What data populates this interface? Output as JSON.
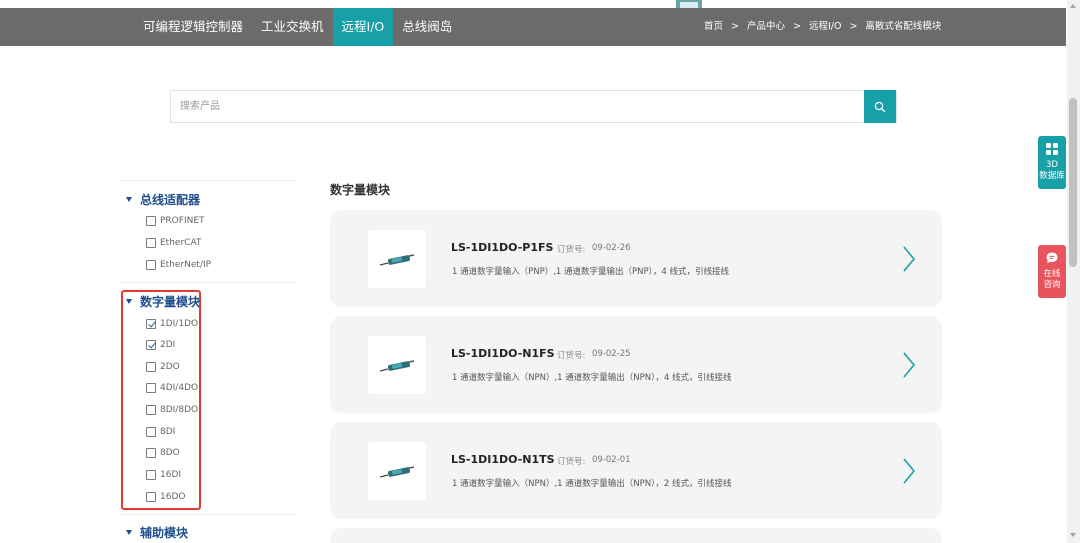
{
  "nav": {
    "items": [
      {
        "label": "可编程逻辑控制器",
        "active": false
      },
      {
        "label": "工业交换机",
        "active": false
      },
      {
        "label": "远程I/O",
        "active": true
      },
      {
        "label": "总线阀岛",
        "active": false
      }
    ],
    "breadcrumb": [
      "首页",
      "产品中心",
      "远程I/O",
      "离散式省配线模块"
    ],
    "breadcrumb_sep": ">",
    "active_color": "#17a0a8",
    "bar_color": "#6b6b6b"
  },
  "search": {
    "placeholder": "搜索产品",
    "value": "",
    "button_icon": "search-icon"
  },
  "sidebar": {
    "groups": [
      {
        "title": "总线适配器",
        "options": [
          {
            "label": "PROFINET",
            "checked": false
          },
          {
            "label": "EtherCAT",
            "checked": false
          },
          {
            "label": "EtherNet/IP",
            "checked": false
          }
        ]
      },
      {
        "title": "数字量模块",
        "options": [
          {
            "label": "1DI/1DO",
            "checked": true
          },
          {
            "label": "2DI",
            "checked": true
          },
          {
            "label": "2DO",
            "checked": false
          },
          {
            "label": "4DI/4DO",
            "checked": false
          },
          {
            "label": "8DI/8DO",
            "checked": false
          },
          {
            "label": "8DI",
            "checked": false
          },
          {
            "label": "8DO",
            "checked": false
          },
          {
            "label": "16DI",
            "checked": false
          },
          {
            "label": "16DO",
            "checked": false
          }
        ]
      },
      {
        "title": "辅助模块",
        "options": []
      }
    ],
    "title_color": "#1f4e8c",
    "highlight_color": "#e03c31"
  },
  "main": {
    "section_title": "数字量模块",
    "order_label": "订货号:",
    "products": [
      {
        "name": "LS-1DI1DO-P1FS",
        "order_no": "09-02-26",
        "desc": "1 通道数字量输入（PNP）,1 通道数字量输出（PNP），4 线式，引线接线"
      },
      {
        "name": "LS-1DI1DO-N1FS",
        "order_no": "09-02-25",
        "desc": "1 通道数字量输入（NPN）,1 通道数字量输出（NPN），4 线式，引线接线"
      },
      {
        "name": "LS-1DI1DO-N1TS",
        "order_no": "09-02-01",
        "desc": "1 通道数字量输入（NPN）,1 通道数字量输出（NPN），2 线式，引线接线"
      }
    ]
  },
  "float_buttons": [
    {
      "icon": "grid-icon",
      "lines": [
        "3D",
        "数据库"
      ],
      "color": "#17a0a8"
    },
    {
      "icon": "chat-icon",
      "lines": [
        "在线",
        "咨询"
      ],
      "color": "#e8545d"
    }
  ]
}
